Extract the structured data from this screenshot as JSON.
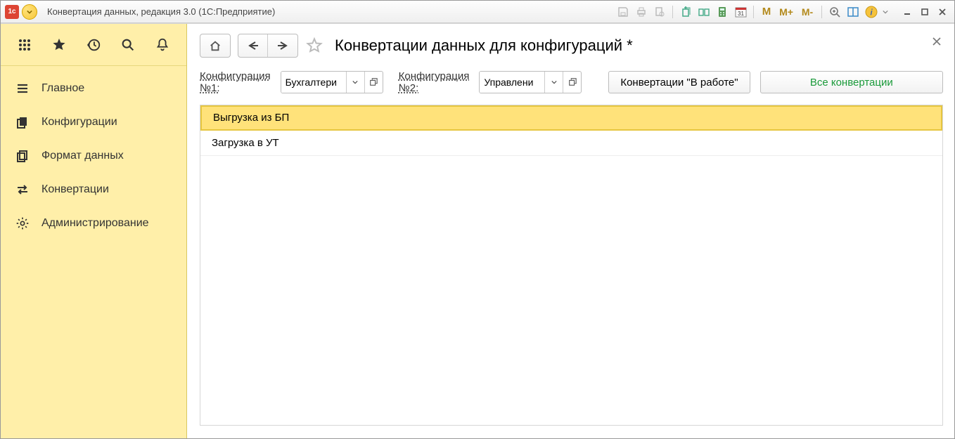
{
  "app": {
    "title": "Конвертация данных, редакция 3.0  (1С:Предприятие)"
  },
  "titlebar_icons": {
    "m1": "M",
    "m2": "M+",
    "m3": "M-",
    "cal_day": "31"
  },
  "sidebar": {
    "items": [
      {
        "label": "Главное"
      },
      {
        "label": "Конфигурации"
      },
      {
        "label": "Формат данных"
      },
      {
        "label": "Конвертации"
      },
      {
        "label": "Администрирование"
      }
    ]
  },
  "page": {
    "title": "Конвертации данных для конфигураций *"
  },
  "filters": {
    "label1a": "Конфигурация",
    "label1b": "№1:",
    "value1": "Бухгалтери",
    "label2a": "Конфигурация",
    "label2b": "№2:",
    "value2": "Управлени",
    "btn_work": "Конвертации \"В работе\"",
    "btn_all": "Все конвертации"
  },
  "list": {
    "rows": [
      "Выгрузка из БП",
      "Загрузка в УТ"
    ]
  }
}
